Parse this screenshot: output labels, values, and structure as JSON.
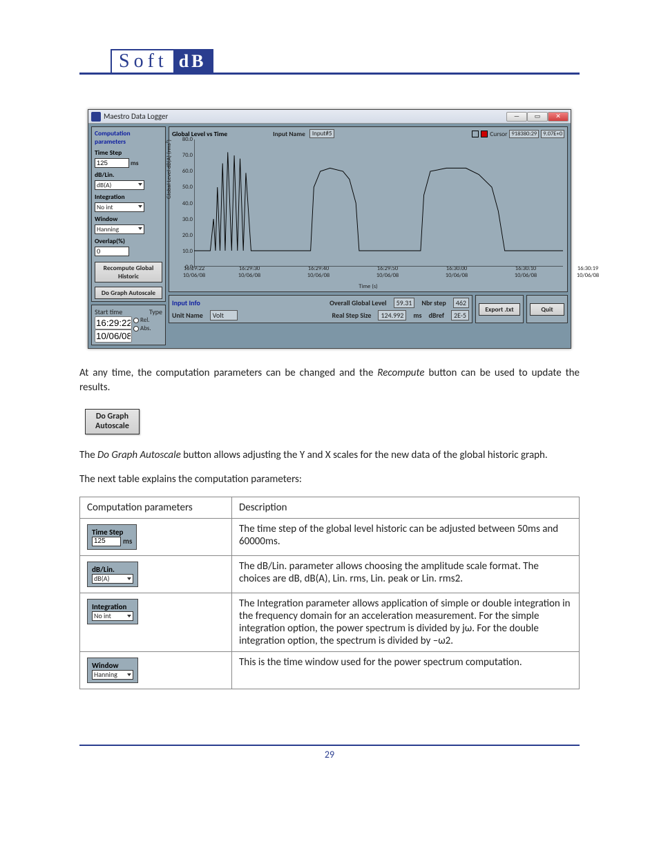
{
  "logo": {
    "left": "Soft",
    "right": "dB"
  },
  "window": {
    "title": "Maestro Data Logger",
    "sidebar": {
      "heading": "Computation parameters",
      "timeStepLabel": "Time Step",
      "timeStepValue": "125",
      "timeStepUnit": "ms",
      "dbLinLabel": "dB/Lin.",
      "dbLinValue": "dB(A)",
      "integrationLabel": "Integration",
      "integrationValue": "No int",
      "windowLabel": "Window",
      "windowValue": "Hanning",
      "overlapLabel": "Overlap(%)",
      "overlapValue": "0",
      "recomputeBtn": "Recompute Global Historic",
      "autoscaleBtn": "Do Graph Autoscale"
    },
    "startTime": {
      "heading": "Start time",
      "typeHeading": "Type",
      "time": "16:29:22",
      "date": "10/06/08",
      "rel": "Rel.",
      "abs": "Abs."
    },
    "chart": {
      "title": "Global Level vs Time",
      "inputNameLabel": "Input Name",
      "inputNameValue": "Input#5",
      "cursorLabel": "Cursor",
      "cursorTime": "918380:29",
      "cursorVal": "9.07E+0",
      "ylabel": "Global Level dB(A) (rms²)",
      "xlabel": "Time (s)"
    },
    "info": {
      "heading": "Input Info",
      "unitNameLabel": "Unit Name",
      "unitNameValue": "Volt",
      "overallLabel": "Overall Global Level",
      "overallValue": "59.31",
      "realStepLabel": "Real Step Size",
      "realStepValue": "124.992",
      "realStepUnit": "ms",
      "nbrStepLabel": "Nbr step",
      "nbrStepValue": "462",
      "dbrefLabel": "dBref",
      "dbrefValue": "2E-5",
      "exportBtn": "Export .txt",
      "quitBtn": "Quit"
    }
  },
  "chart_data": {
    "type": "line",
    "title": "Global Level vs Time",
    "ylabel": "Global Level dB(A) (rms²)",
    "xlabel": "Time (s)",
    "ylim": [
      0,
      80
    ],
    "yticks": [
      0,
      10,
      20,
      30,
      40,
      50,
      60,
      70,
      80
    ],
    "xticks": [
      "16:29:22 10/06/08",
      "16:29:30 10/06/08",
      "16:29:40 10/06/08",
      "16:29:50 10/06/08",
      "16:30:00 10/06/08",
      "16:30:10 10/06/08",
      "16:30:19 10/06/08"
    ],
    "x_seconds": [
      0,
      8,
      18,
      28,
      38,
      48,
      57
    ],
    "series": [
      {
        "name": "Global Level",
        "points": [
          [
            0,
            10
          ],
          [
            1,
            10
          ],
          [
            2,
            10
          ],
          [
            2.5,
            10
          ],
          [
            3,
            30
          ],
          [
            3.3,
            10
          ],
          [
            3.6,
            50
          ],
          [
            4,
            10
          ],
          [
            4.4,
            65
          ],
          [
            4.8,
            10
          ],
          [
            5.2,
            72
          ],
          [
            5.8,
            10
          ],
          [
            6.2,
            70
          ],
          [
            6.7,
            10
          ],
          [
            7.1,
            68
          ],
          [
            7.6,
            10
          ],
          [
            8.0,
            59
          ],
          [
            8.8,
            10
          ],
          [
            9.0,
            10
          ],
          [
            18,
            10
          ],
          [
            18.5,
            50
          ],
          [
            19.5,
            60
          ],
          [
            21,
            62
          ],
          [
            23,
            60
          ],
          [
            24,
            55
          ],
          [
            25,
            40
          ],
          [
            25.5,
            10
          ],
          [
            26,
            10
          ],
          [
            28,
            10
          ],
          [
            35,
            10
          ],
          [
            35.5,
            45
          ],
          [
            36.5,
            60
          ],
          [
            39,
            62
          ],
          [
            42,
            62
          ],
          [
            44,
            58
          ],
          [
            46,
            50
          ],
          [
            47,
            35
          ],
          [
            48,
            10
          ],
          [
            49,
            10
          ],
          [
            57,
            10
          ]
        ]
      }
    ]
  },
  "paragraphs": {
    "p1a": "At any time, the computation parameters can be changed and the ",
    "p1i": "Recompute",
    "p1b": " button can be used to update the results.",
    "btnAutoscale": "Do Graph\nAutoscale",
    "p2a": "The ",
    "p2i": "Do Graph Autoscale",
    "p2b": " button allows adjusting the Y and X scales for the new data of the global historic graph.",
    "p3": "The next table explains the computation parameters:"
  },
  "table": {
    "h1": "Computation parameters",
    "h2": "Description",
    "rows": [
      {
        "panel": {
          "title": "Time Step",
          "value": "125",
          "unit": "ms",
          "type": "input"
        },
        "desc": "The time step of the global level historic can be adjusted between 50ms and 60000ms."
      },
      {
        "panel": {
          "title": "dB/Lin.",
          "value": "dB(A)",
          "type": "combo"
        },
        "desc": "The dB/Lin. parameter allows choosing the amplitude scale format. The choices are dB, dB(A), Lin. rms, Lin. peak or Lin. rms2."
      },
      {
        "panel": {
          "title": "Integration",
          "value": "No int",
          "type": "combo"
        },
        "desc": "The Integration parameter allows application of simple or double integration in the frequency domain for an acceleration measurement. For the simple integration option, the power spectrum is divided by jω.  For the double integration option, the spectrum is divided by –ω2."
      },
      {
        "panel": {
          "title": "Window",
          "value": "Hanning",
          "type": "combo"
        },
        "desc": "This is the time window used for the power spectrum computation."
      }
    ]
  },
  "pageNumber": "29"
}
